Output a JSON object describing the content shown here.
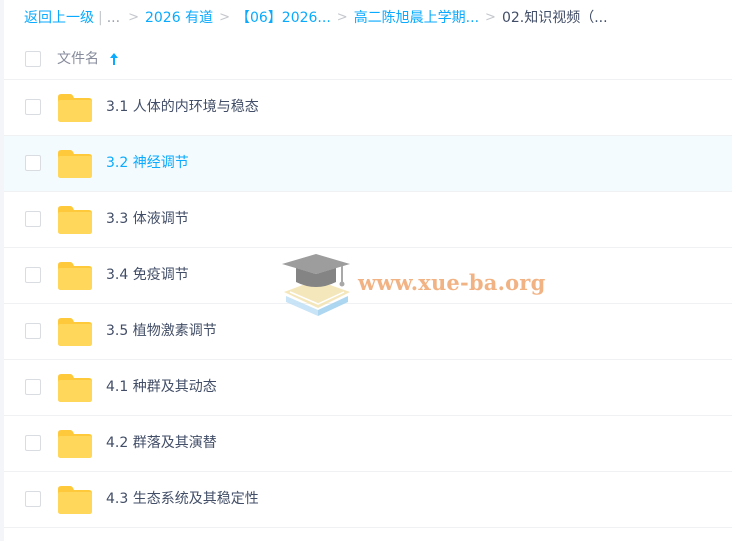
{
  "breadcrumb": {
    "back_label": "返回上一级",
    "pipe": "|",
    "ellipsis": "...",
    "sep": ">",
    "items": [
      "2026 有道",
      "【06】2026...",
      "高二陈旭晨上学期...",
      "02.知识视频（..."
    ]
  },
  "header": {
    "filename_label": "文件名",
    "sort_icon": "arrow-up-icon"
  },
  "files": [
    {
      "name": "3.1 人体的内环境与稳态",
      "icon": "folder-icon"
    },
    {
      "name": "3.2 神经调节",
      "icon": "folder-icon"
    },
    {
      "name": "3.3 体液调节",
      "icon": "folder-icon"
    },
    {
      "name": "3.4 免疫调节",
      "icon": "folder-icon"
    },
    {
      "name": "3.5 植物激素调节",
      "icon": "folder-icon"
    },
    {
      "name": "4.1 种群及其动态",
      "icon": "folder-icon"
    },
    {
      "name": "4.2 群落及其演替",
      "icon": "folder-icon"
    },
    {
      "name": "4.3 生态系统及其稳定性",
      "icon": "folder-icon"
    }
  ],
  "watermark": {
    "text": "www.xue-ba.org"
  },
  "colors": {
    "link": "#09aaff",
    "text": "#424e67",
    "muted": "#878c9c",
    "folder": "#ffd24c",
    "hover_row": "#f4fbff",
    "watermark_text": "#ee9a5b"
  }
}
